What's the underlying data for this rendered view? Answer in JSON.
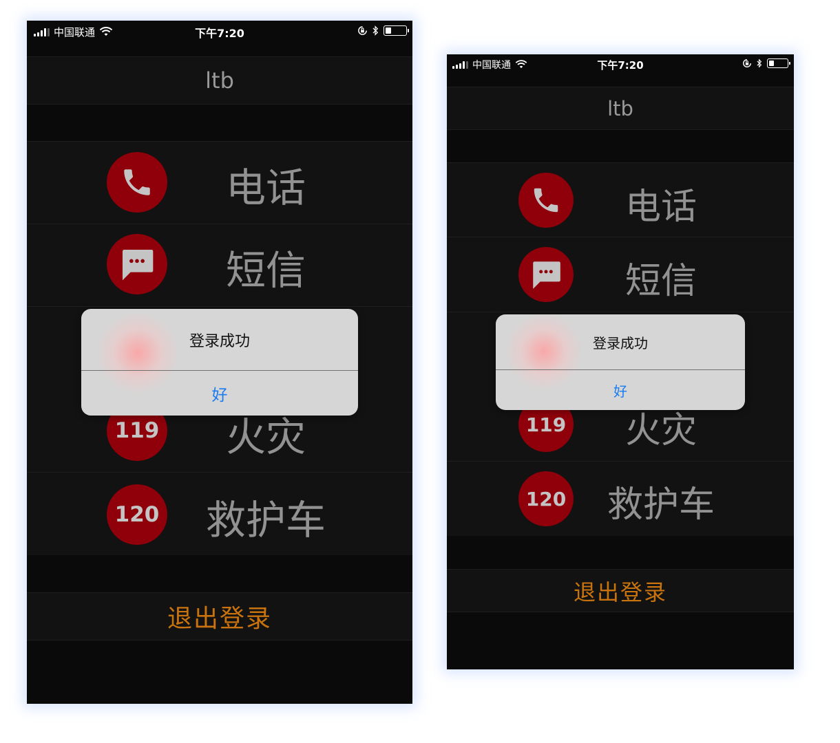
{
  "status": {
    "carrier": "中国联通",
    "time": "下午7:20"
  },
  "nav": {
    "title": "ltb"
  },
  "menu": [
    {
      "icon": "phone-icon",
      "label": "电话"
    },
    {
      "icon": "message-icon",
      "label": "短信"
    },
    {
      "icon": "number-icon",
      "number": "119",
      "label": "火灾"
    },
    {
      "icon": "number-icon",
      "number": "120",
      "label": "救护车"
    }
  ],
  "logout": {
    "label": "退出登录"
  },
  "alert": {
    "title": "登录成功",
    "ok": "好"
  },
  "colors": {
    "accent_red": "#8f000a",
    "logout_orange": "#c9730f",
    "alert_link_blue": "#1a7cf0"
  }
}
